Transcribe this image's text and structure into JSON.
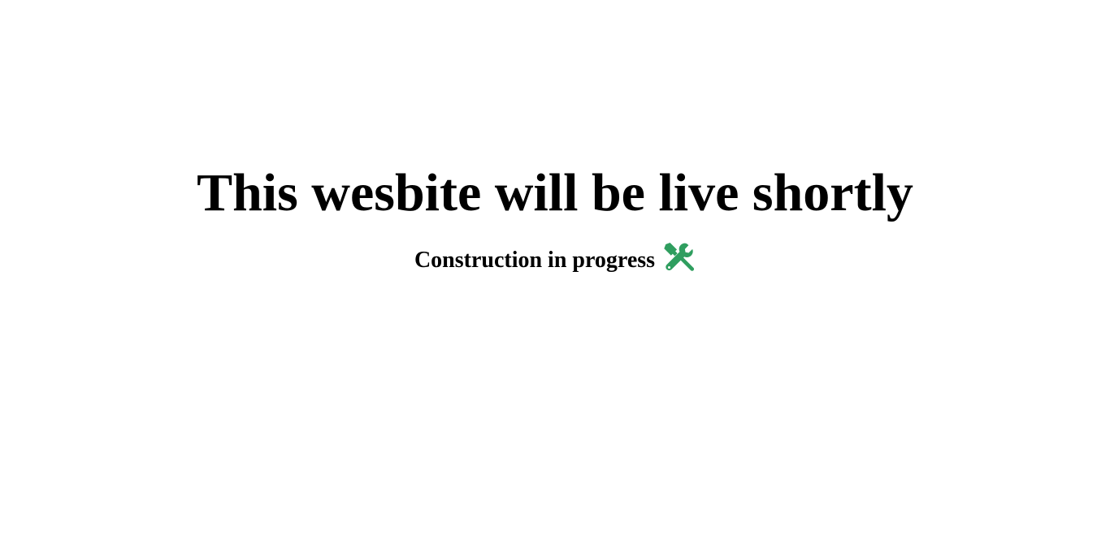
{
  "main": {
    "title": "This wesbite will be live shortly",
    "subtitle": "Construction in progress",
    "icon": {
      "name": "hammer-wrench-icon",
      "color": "#2f9e5f"
    }
  }
}
